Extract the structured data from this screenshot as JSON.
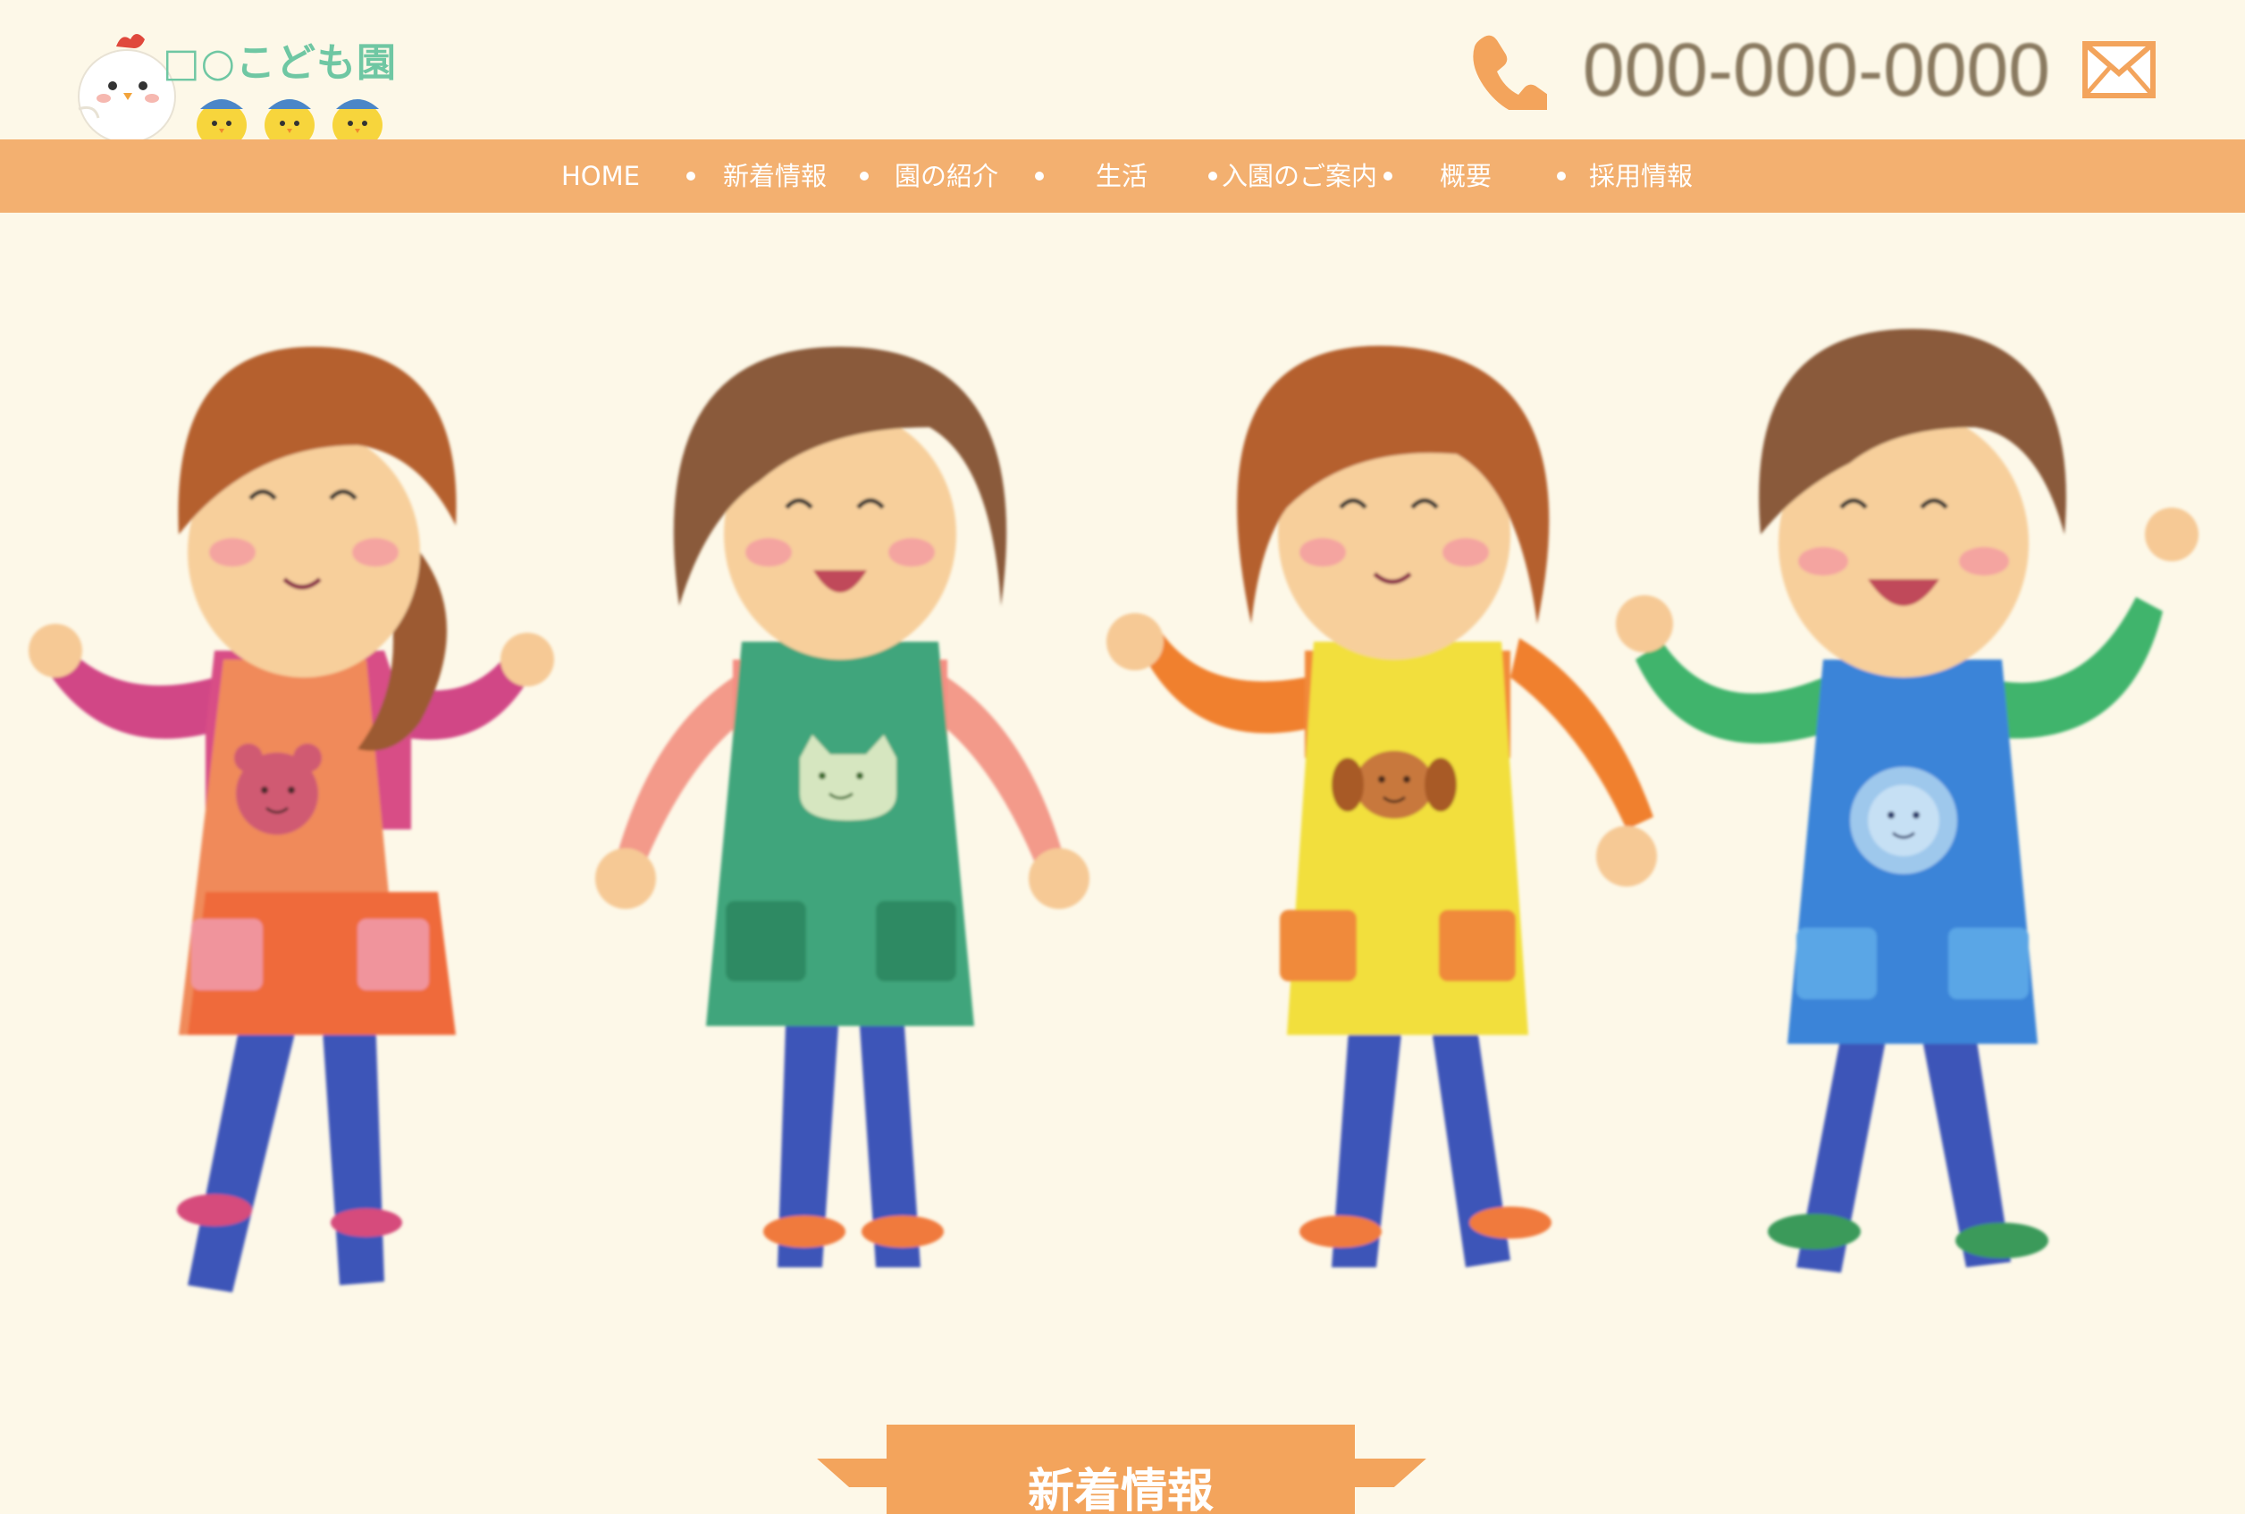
{
  "brand": {
    "name": "□○こども園"
  },
  "contact": {
    "phone": "000-000-0000",
    "phone_icon": "phone-icon",
    "mail_icon": "mail-icon"
  },
  "nav": {
    "items": [
      {
        "label": "HOME"
      },
      {
        "label": "新着情報"
      },
      {
        "label": "園の紹介"
      },
      {
        "label": "生活"
      },
      {
        "label": "入園のご案内"
      },
      {
        "label": "概要"
      },
      {
        "label": "採用情報"
      }
    ]
  },
  "hero": {
    "illustration": "four smiling teachers in colorful aprons (bear, cat, dog, lion)"
  },
  "section": {
    "heading": "新着情報"
  },
  "colors": {
    "background": "#fdf8e8",
    "nav": "#f3b070",
    "accent": "#f3a45c",
    "logo_text": "#6fc7a3"
  }
}
